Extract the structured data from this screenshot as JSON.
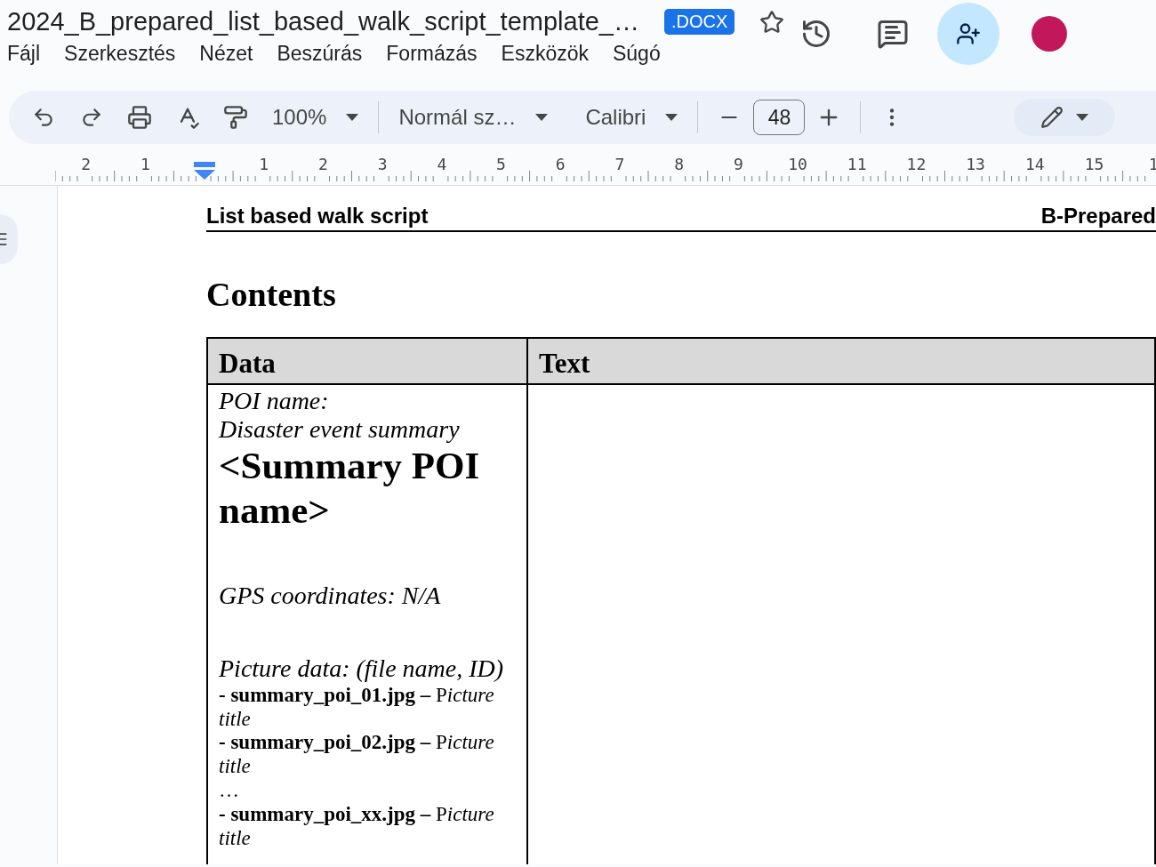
{
  "document_title": "2024_B_prepared_list_based_walk_script_template_…",
  "file_badge": ".DOCX",
  "menu": [
    "Fájl",
    "Szerkesztés",
    "Nézet",
    "Beszúrás",
    "Formázás",
    "Eszközök",
    "Súgó"
  ],
  "toolbar": {
    "zoom": "100%",
    "style": "Normál sz…",
    "font": "Calibri",
    "font_size": "48"
  },
  "ruler": {
    "negative_labels": [
      "2",
      "1"
    ],
    "labels": [
      "1",
      "2",
      "3",
      "4",
      "5",
      "6",
      "7",
      "8",
      "9",
      "10",
      "11",
      "12",
      "13",
      "14",
      "15",
      "1"
    ]
  },
  "page": {
    "header_left": "List based walk script",
    "header_right": "B-Prepared",
    "heading": "Contents",
    "table": {
      "columns": [
        "Data",
        "Text"
      ],
      "data_cell": [
        {
          "kind": "italic",
          "text": "POI name:"
        },
        {
          "kind": "italic",
          "text": "Disaster event summary"
        },
        {
          "kind": "title",
          "text": "<Summary POI name>"
        },
        {
          "kind": "section",
          "text": "GPS coordinates: N/A"
        },
        {
          "kind": "section",
          "text": "Picture data: (file name, ID)"
        },
        {
          "kind": "file",
          "name": "- summary_poi_01.jpg –",
          "initial": "P",
          "caption": "icture title"
        },
        {
          "kind": "file",
          "name": "- summary_poi_02.jpg –",
          "initial": "P",
          "caption": "icture title"
        },
        {
          "kind": "ellipsis",
          "text": "…"
        },
        {
          "kind": "file",
          "name": "- summary_poi_xx.jpg –",
          "initial": "P",
          "caption": "icture title"
        }
      ]
    }
  }
}
